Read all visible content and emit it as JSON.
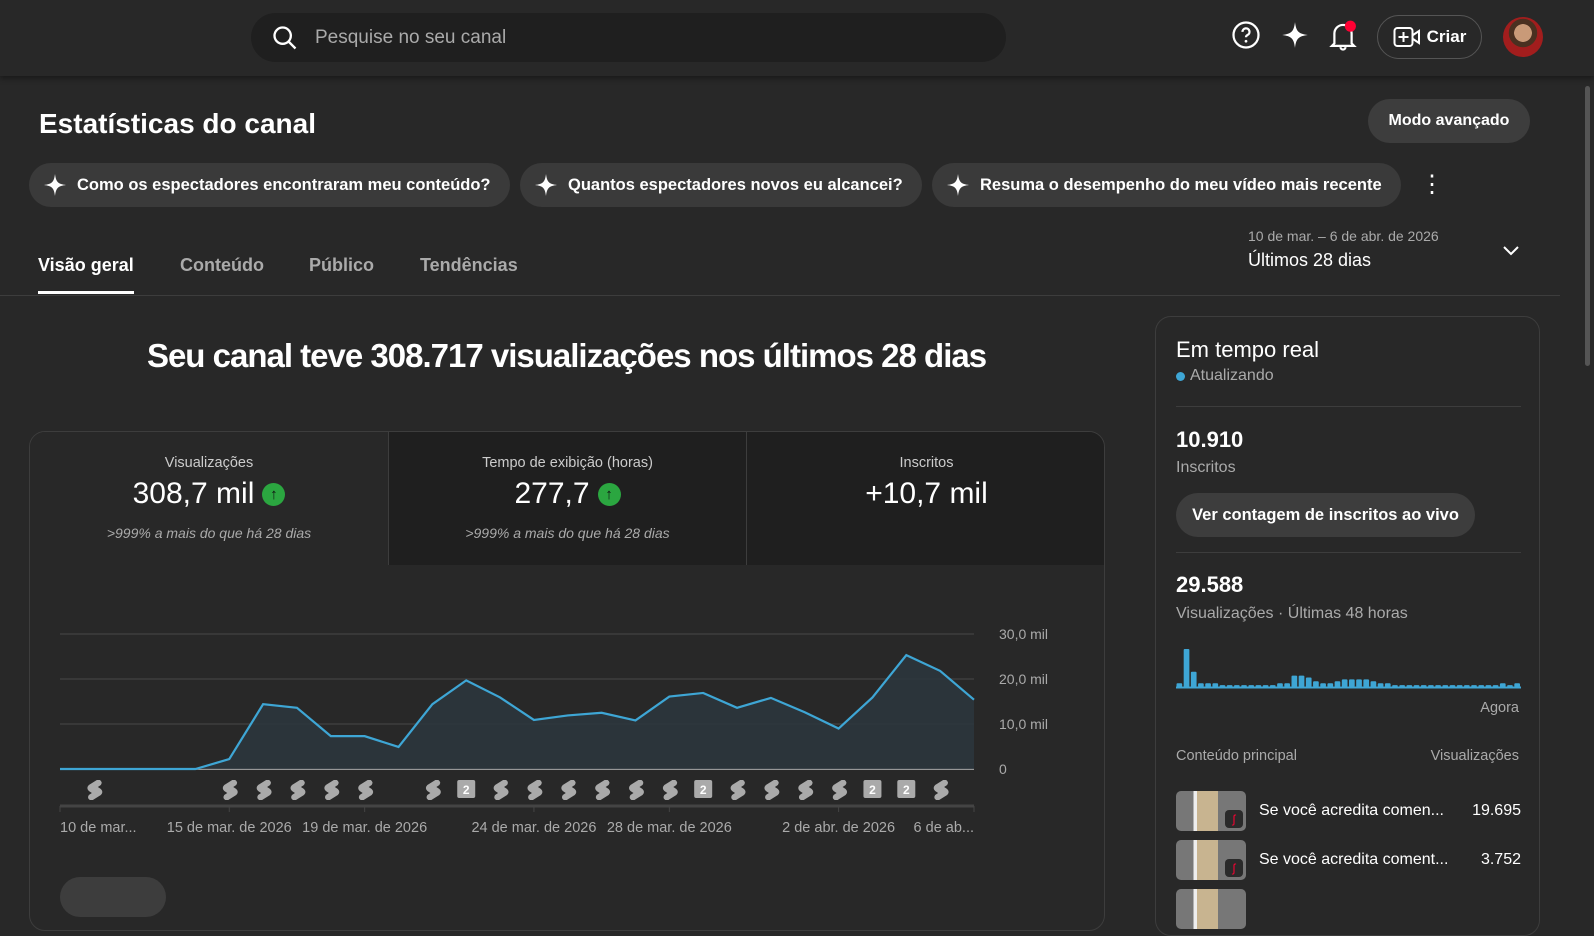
{
  "search": {
    "placeholder": "Pesquise no seu canal"
  },
  "header": {
    "create_label": "Criar"
  },
  "page": {
    "title": "Estatísticas do canal",
    "advanced_mode": "Modo avançado"
  },
  "chips": [
    "Como os espectadores encontraram meu conteúdo?",
    "Quantos espectadores novos eu alcancei?",
    "Resuma o desempenho do meu vídeo mais recente"
  ],
  "tabs": [
    "Visão geral",
    "Conteúdo",
    "Público",
    "Tendências"
  ],
  "date_range": {
    "dates": "10 de mar. – 6 de abr. de 2026",
    "label": "Últimos 28 dias"
  },
  "headline": "Seu canal teve 308.717 visualizações nos últimos 28 dias",
  "metrics": [
    {
      "label": "Visualizações",
      "value": "308,7 mil",
      "compare": ">999% a mais do que há 28 dias"
    },
    {
      "label": "Tempo de exibição (horas)",
      "value": "277,7",
      "compare": ">999% a mais do que há 28 dias"
    },
    {
      "label": "Inscritos",
      "value": "+10,7 mil"
    }
  ],
  "chart_data": {
    "type": "area",
    "title": "Visualizações",
    "ylim": [
      0,
      30000
    ],
    "yticks": [
      "0",
      "10,0 mil",
      "20,0 mil",
      "30,0 mil"
    ],
    "xtick_labels": [
      {
        "i": 0,
        "label": "10 de mar..."
      },
      {
        "i": 5,
        "label": "15 de mar. de 2026"
      },
      {
        "i": 9,
        "label": "19 de mar. de 2026"
      },
      {
        "i": 14,
        "label": "24 de mar. de 2026"
      },
      {
        "i": 18,
        "label": "28 de mar. de 2026"
      },
      {
        "i": 23,
        "label": "2 de abr. de 2026"
      },
      {
        "i": 27,
        "label": "6 de ab..."
      }
    ],
    "values": [
      0,
      0,
      0,
      0,
      0,
      2200,
      14400,
      13600,
      7300,
      7300,
      4900,
      14400,
      19700,
      15900,
      10900,
      11900,
      12500,
      10800,
      16100,
      16900,
      13600,
      15800,
      12600,
      9000,
      15900,
      25300,
      21800,
      15400
    ],
    "markers": [
      {
        "i": 1
      },
      {
        "i": 5
      },
      {
        "i": 6
      },
      {
        "i": 7
      },
      {
        "i": 8
      },
      {
        "i": 9
      },
      {
        "i": 11
      },
      {
        "i": 12,
        "count": "2"
      },
      {
        "i": 13
      },
      {
        "i": 14
      },
      {
        "i": 15
      },
      {
        "i": 16
      },
      {
        "i": 17
      },
      {
        "i": 18
      },
      {
        "i": 19,
        "count": "2"
      },
      {
        "i": 20
      },
      {
        "i": 21
      },
      {
        "i": 22
      },
      {
        "i": 23
      },
      {
        "i": 24,
        "count": "2"
      },
      {
        "i": 25,
        "count": "2"
      },
      {
        "i": 26
      }
    ],
    "color": "#3ea6d5"
  },
  "realtime": {
    "title": "Em tempo real",
    "status": "Atualizando",
    "subscribers": "10.910",
    "subscribers_label": "Inscritos",
    "live_button": "Ver contagem de inscritos ao vivo",
    "views": "29.588",
    "views_label": "Visualizações · Últimas 48 horas",
    "now_label": "Agora",
    "bars": [
      1,
      10,
      4,
      1,
      1,
      1,
      0.5,
      0.5,
      0.5,
      0.5,
      0.5,
      0.5,
      0.5,
      0.5,
      1,
      1,
      3,
      3,
      2.5,
      1.5,
      1,
      1,
      1.5,
      2,
      2,
      2,
      2,
      1.5,
      1,
      1,
      0.5,
      0.5,
      0.5,
      0.5,
      0.5,
      0.5,
      0.5,
      0.5,
      0.5,
      0.5,
      0.5,
      0.5,
      0.5,
      0.5,
      0.5,
      1,
      0.5,
      1
    ],
    "content_header": "Conteúdo principal",
    "views_header": "Visualizações",
    "top_content": [
      {
        "title": "Se você acredita comen...",
        "views": "19.695"
      },
      {
        "title": "Se você acredita coment...",
        "views": "3.752"
      }
    ]
  }
}
